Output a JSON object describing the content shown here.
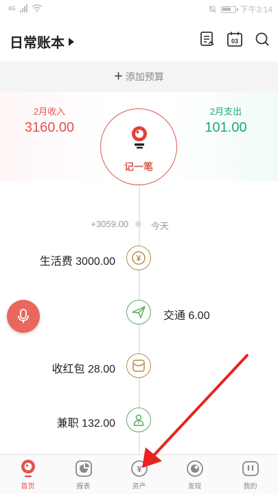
{
  "status_bar": {
    "signal": "4G",
    "time": "下午3:14"
  },
  "header": {
    "title": "日常账本"
  },
  "budget": {
    "plus": "+",
    "label": "添加预算"
  },
  "summary": {
    "income_label": "2月收入",
    "income_value": "3160.00",
    "expense_label": "2月支出",
    "expense_value": "101.00"
  },
  "record_button": {
    "label": "记一笔"
  },
  "timeline": {
    "date_amount": "+3059.00",
    "date_label": "今天",
    "entries": [
      {
        "text": "生活费 3000.00",
        "side": "left",
        "icon": "yen-icon"
      },
      {
        "text": "交通 6.00",
        "side": "right",
        "icon": "paper-plane-icon"
      },
      {
        "text": "收红包 28.00",
        "side": "left",
        "icon": "envelope-icon"
      },
      {
        "text": "兼职 132.00",
        "side": "left",
        "icon": "person-icon"
      }
    ]
  },
  "nav": {
    "items": [
      {
        "label": "首页",
        "icon": "home-icon",
        "active": true
      },
      {
        "label": "报表",
        "icon": "pie-chart-icon",
        "active": false
      },
      {
        "label": "资产",
        "icon": "yen-circle-icon",
        "active": false
      },
      {
        "label": "发现",
        "icon": "discover-icon",
        "active": false
      },
      {
        "label": "我的",
        "icon": "profile-icon",
        "active": false
      }
    ]
  },
  "colors": {
    "income": "#e2534f",
    "expense": "#17a97f",
    "accent": "#d9584d",
    "income_entry": "#b8894a",
    "expense_entry": "#5aa862",
    "annotation_arrow": "#e8231f"
  }
}
